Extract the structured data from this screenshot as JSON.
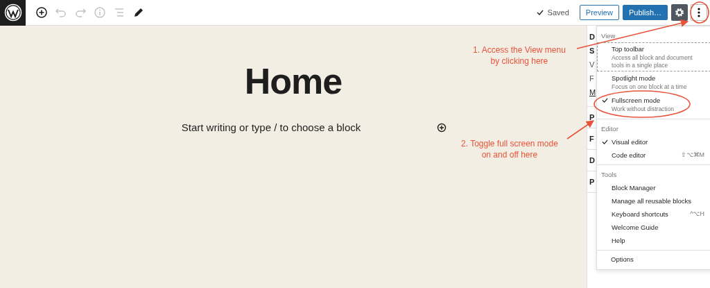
{
  "toolbar": {
    "tools": [
      {
        "kind": "add",
        "disabled": false
      },
      {
        "kind": "undo",
        "disabled": true
      },
      {
        "kind": "redo",
        "disabled": true
      },
      {
        "kind": "info",
        "disabled": true
      },
      {
        "kind": "outline",
        "disabled": true
      },
      {
        "kind": "edit",
        "disabled": false
      }
    ],
    "status": "Saved",
    "preview": "Preview",
    "publish": "Publish…",
    "settings_selected": true,
    "more_expanded": true
  },
  "canvas": {
    "title": "Home",
    "prompt": "Start writing or type / to choose a block"
  },
  "sidebar": {
    "top_letters": [
      "D",
      "S",
      "V",
      "F",
      "M"
    ],
    "panels": [
      "P",
      "F",
      "D",
      "P"
    ]
  },
  "menu": {
    "groups": [
      {
        "label": "View",
        "items": [
          {
            "label": "Top toolbar",
            "description": "Access all block and document tools in a single place",
            "checked": false,
            "focused": true
          },
          {
            "label": "Spotlight mode",
            "description": "Focus on one block at a time",
            "checked": false,
            "focused": false
          },
          {
            "label": "Fullscreen mode",
            "description": "Work without distraction",
            "checked": true,
            "focused": false
          }
        ]
      },
      {
        "label": "Editor",
        "items": [
          {
            "label": "Visual editor",
            "checked": true,
            "focused": false
          },
          {
            "label": "Code editor",
            "shortcut": "⇧⌥⌘M",
            "checked": false,
            "focused": false
          }
        ]
      },
      {
        "label": "Tools",
        "items": [
          {
            "label": "Block Manager",
            "checked": false,
            "focused": false
          },
          {
            "label": "Manage all reusable blocks",
            "checked": false,
            "focused": false
          },
          {
            "label": "Keyboard shortcuts",
            "shortcut": "^⌥H",
            "checked": false,
            "focused": false
          },
          {
            "label": "Welcome Guide",
            "checked": false,
            "focused": false
          },
          {
            "label": "Help",
            "checked": false,
            "focused": false
          }
        ]
      }
    ],
    "footer": "Options"
  },
  "annotations": [
    {
      "lines": [
        "1. Access the View menu",
        "by clicking here"
      ]
    },
    {
      "lines": [
        "2. Toggle full screen mode",
        "on and off here"
      ]
    }
  ]
}
